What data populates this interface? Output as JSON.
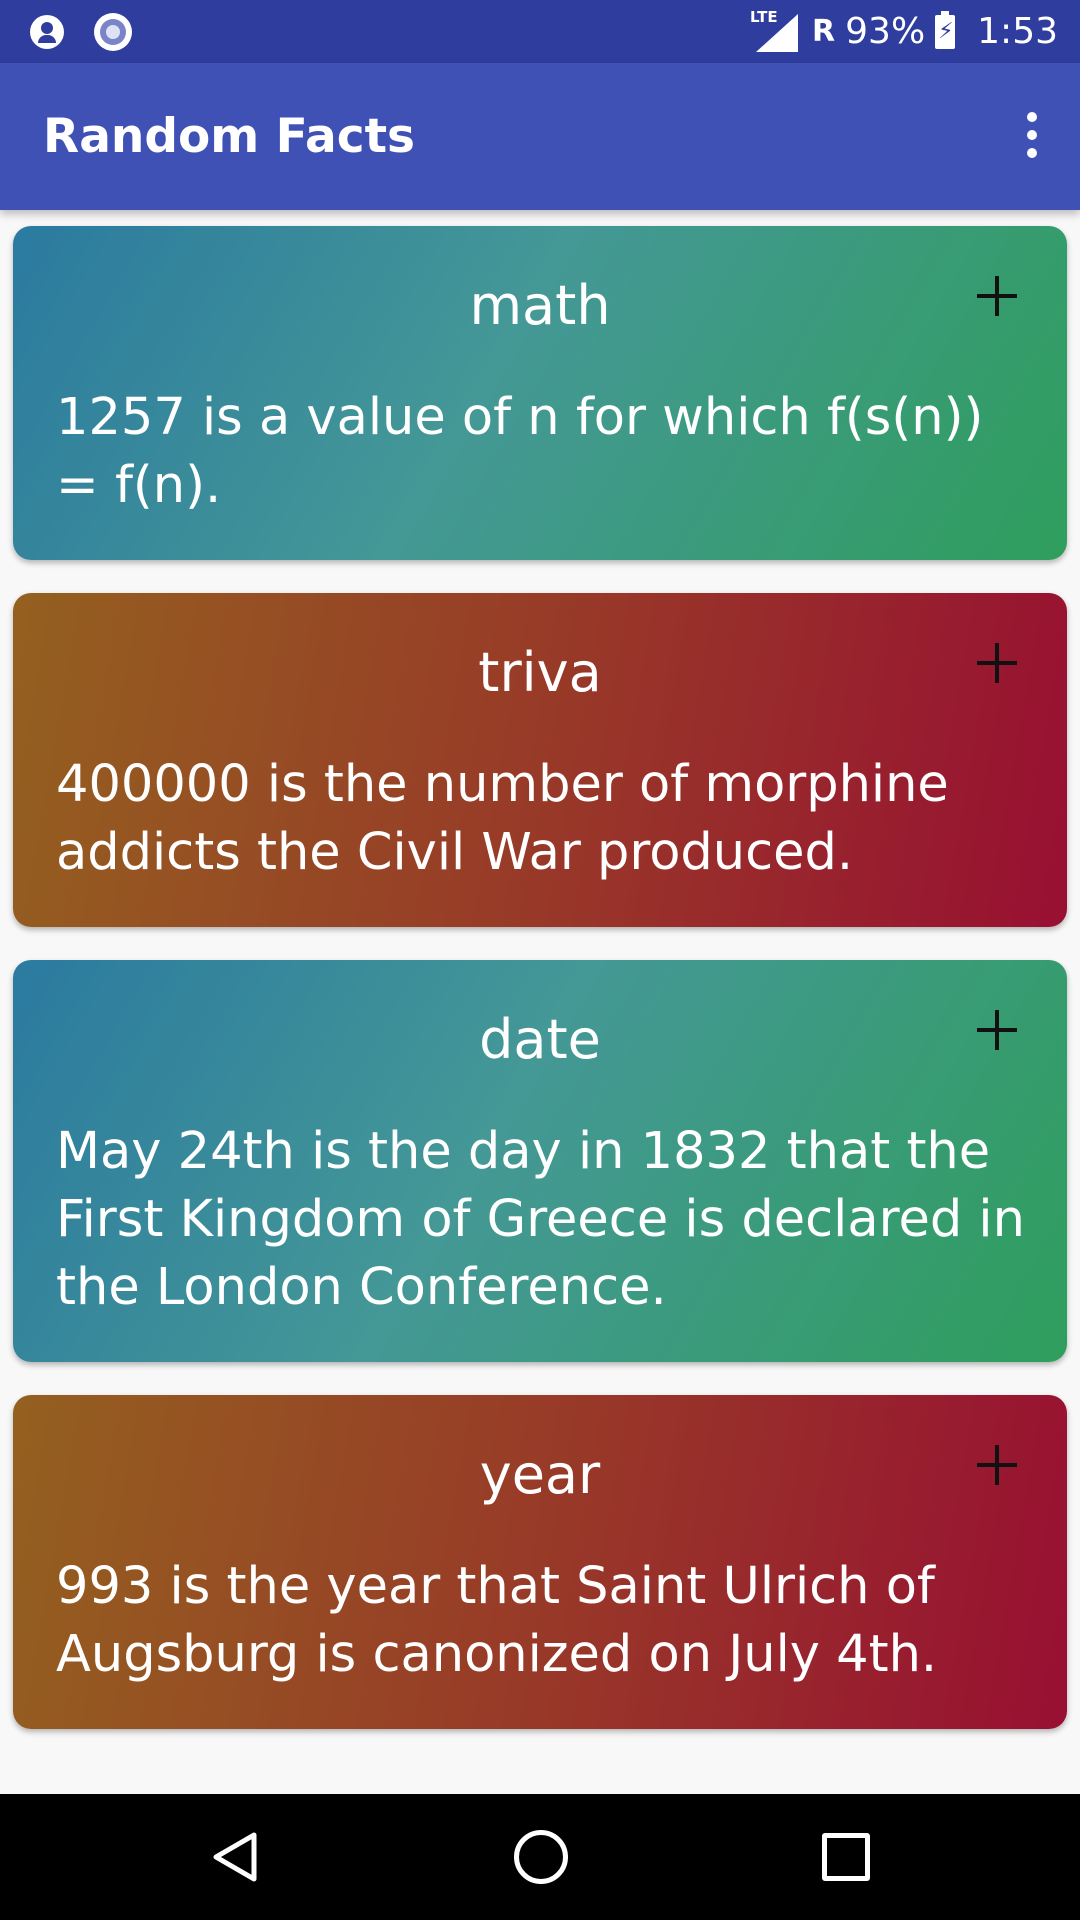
{
  "status_bar": {
    "network_type": "LTE",
    "roaming": "R",
    "battery": "93%",
    "time": "1:53",
    "left_icons": [
      "account-icon",
      "sync-icon"
    ]
  },
  "app_bar": {
    "title": "Random Facts",
    "menu_icon": "more-vert-icon"
  },
  "cards": [
    {
      "category": "math",
      "fact": "1257 is a value of n for which f(s(n)) = f(n).",
      "action_icon": "plus-icon",
      "style": "teal-green-gradient"
    },
    {
      "category": "triva",
      "fact": "400000 is the number of morphine addicts the Civil War produced.",
      "action_icon": "plus-icon",
      "style": "amber-crimson-gradient"
    },
    {
      "category": "date",
      "fact": "May 24th is the day in 1832 that the First Kingdom of Greece is declared in the London Conference.",
      "action_icon": "plus-icon",
      "style": "teal-green-gradient"
    },
    {
      "category": "year",
      "fact": "993 is the year that Saint Ulrich of Augsburg is canonized on July 4th.",
      "action_icon": "plus-icon",
      "style": "amber-crimson-gradient"
    }
  ],
  "nav_bar": {
    "buttons": [
      "back-icon",
      "home-icon",
      "recents-icon"
    ]
  },
  "colors": {
    "status_bar": "#2f3e9e",
    "app_bar": "#3f51b5",
    "background": "#f8f8f8",
    "teal_start": "#2b7aa0",
    "teal_mid": "#449896",
    "teal_end": "#2f9e5c",
    "rust_start": "#94601f",
    "rust_mid": "#983a28",
    "rust_end": "#980f32"
  }
}
